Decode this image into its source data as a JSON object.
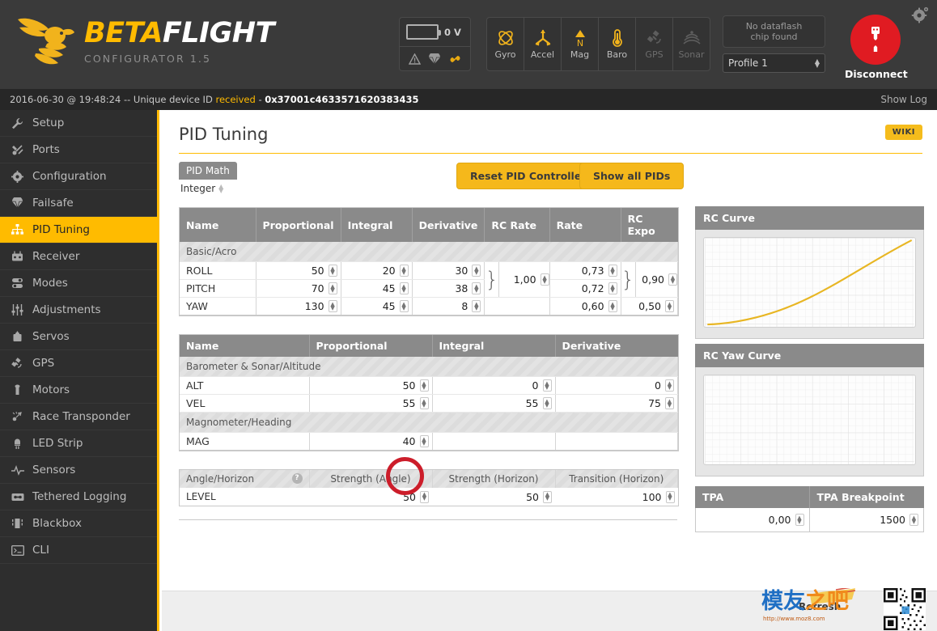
{
  "app": {
    "brand_beta": "BETA",
    "brand_flight": "FLIGHT",
    "subtitle": "CONFIGURATOR 1.5",
    "accent": "#ffbb00",
    "danger": "#e01b22"
  },
  "header": {
    "battery_voltage": "0 V",
    "battery_icons": [
      "warning-icon",
      "parachute-icon",
      "link-icon"
    ],
    "sensors": [
      {
        "label": "Gyro",
        "icon": "gyro-icon",
        "active": true
      },
      {
        "label": "Accel",
        "icon": "accel-icon",
        "active": true
      },
      {
        "label": "Mag",
        "icon": "mag-icon",
        "active": true
      },
      {
        "label": "Baro",
        "icon": "baro-icon",
        "active": true
      },
      {
        "label": "GPS",
        "icon": "gps-icon",
        "active": false
      },
      {
        "label": "Sonar",
        "icon": "sonar-icon",
        "active": false
      }
    ],
    "dataflash_line1": "No dataflash",
    "dataflash_line2": "chip found",
    "profile": "Profile 1",
    "connect_label": "Disconnect",
    "gear_icon": "gear-icon"
  },
  "statusbar": {
    "prefix": "2016-06-30 @ 19:48:24 -- Unique device ID ",
    "highlight": "received",
    "separator": " - ",
    "device_id": "0x37001c4633571620383435",
    "show_log": "Show Log"
  },
  "sidebar": {
    "items": [
      {
        "label": "Setup",
        "icon": "wrench-icon",
        "active": false
      },
      {
        "label": "Ports",
        "icon": "plug-icon",
        "active": false
      },
      {
        "label": "Configuration",
        "icon": "gear-icon",
        "active": false
      },
      {
        "label": "Failsafe",
        "icon": "parachute-icon",
        "active": false
      },
      {
        "label": "PID Tuning",
        "icon": "sitemap-icon",
        "active": true
      },
      {
        "label": "Receiver",
        "icon": "transmitter-icon",
        "active": false
      },
      {
        "label": "Modes",
        "icon": "toggles-icon",
        "active": false
      },
      {
        "label": "Adjustments",
        "icon": "sliders-icon",
        "active": false
      },
      {
        "label": "Servos",
        "icon": "servo-icon",
        "active": false
      },
      {
        "label": "GPS",
        "icon": "satellite-icon",
        "active": false
      },
      {
        "label": "Motors",
        "icon": "motor-icon",
        "active": false
      },
      {
        "label": "Race Transponder",
        "icon": "transponder-icon",
        "active": false
      },
      {
        "label": "LED Strip",
        "icon": "led-icon",
        "active": false
      },
      {
        "label": "Sensors",
        "icon": "waveform-icon",
        "active": false
      },
      {
        "label": "Tethered Logging",
        "icon": "cassette-icon",
        "active": false
      },
      {
        "label": "Blackbox",
        "icon": "blackbox-icon",
        "active": false
      },
      {
        "label": "CLI",
        "icon": "terminal-icon",
        "active": false
      }
    ]
  },
  "page": {
    "title": "PID Tuning",
    "wiki_label": "WIKI",
    "pid_math_label": "PID Math",
    "pid_math_value": "Integer",
    "reset_button": "Reset PID Controller",
    "show_all_button": "Show all PIDs"
  },
  "pid_table": {
    "headers": [
      "Name",
      "Proportional",
      "Integral",
      "Derivative",
      "RC Rate",
      "Rate",
      "RC Expo"
    ],
    "group_label": "Basic/Acro",
    "rows": [
      {
        "name": "ROLL",
        "p": "50",
        "i": "20",
        "d": "30",
        "rate": "0,73"
      },
      {
        "name": "PITCH",
        "p": "70",
        "i": "45",
        "d": "38",
        "rate": "0,72"
      },
      {
        "name": "YAW",
        "p": "130",
        "i": "45",
        "d": "8",
        "rate": "0,60"
      }
    ],
    "rc_rate_shared": "1,00",
    "rc_expo_shared": "0,90",
    "yaw_rc_expo": "0,50"
  },
  "alt_table": {
    "headers": [
      "Name",
      "Proportional",
      "Integral",
      "Derivative"
    ],
    "group1_label": "Barometer & Sonar/Altitude",
    "group2_label": "Magnometer/Heading",
    "rows": [
      {
        "name": "ALT",
        "p": "50",
        "i": "0",
        "d": "0"
      },
      {
        "name": "VEL",
        "p": "55",
        "i": "55",
        "d": "75"
      }
    ],
    "mag_row": {
      "name": "MAG",
      "p": "40",
      "i": "",
      "d": ""
    }
  },
  "angle_table": {
    "headers": [
      "Angle/Horizon",
      "Strength (Angle)",
      "Strength (Horizon)",
      "Transition (Horizon)"
    ],
    "help_icon": "help-icon",
    "row": {
      "name": "LEVEL",
      "strength_angle": "50",
      "strength_horizon": "50",
      "transition_horizon": "100"
    }
  },
  "right_panels": {
    "rc_curve_title": "RC Curve",
    "rc_yaw_curve_title": "RC Yaw Curve",
    "tpa_title": "TPA",
    "tpa_breakpoint_title": "TPA Breakpoint",
    "tpa_value": "0,00",
    "tpa_breakpoint_value": "1500"
  },
  "chart_data": [
    {
      "type": "line",
      "title": "RC Curve",
      "x": [
        0,
        0.1,
        0.2,
        0.3,
        0.4,
        0.5,
        0.6,
        0.7,
        0.8,
        0.9,
        1.0
      ],
      "values": [
        0.01,
        0.02,
        0.05,
        0.09,
        0.15,
        0.23,
        0.33,
        0.46,
        0.62,
        0.8,
        1.0
      ],
      "series_color": "#e8b623",
      "grid": true,
      "xlabel": "",
      "ylabel": "",
      "xlim": [
        0,
        1
      ],
      "ylim": [
        0,
        1
      ],
      "legend": "none"
    },
    {
      "type": "line",
      "title": "RC Yaw Curve",
      "x": [],
      "values": [],
      "grid": true,
      "xlabel": "",
      "ylabel": "",
      "xlim": [
        0,
        1
      ],
      "ylim": [
        0,
        1
      ],
      "legend": "none"
    }
  ],
  "footer": {
    "refresh_label": "Refresh",
    "watermark_cn_blue": "模友",
    "watermark_cn_orange": "之吧",
    "watermark_url": "http://www.moz8.com",
    "qr_icon": "qr-code-icon"
  }
}
